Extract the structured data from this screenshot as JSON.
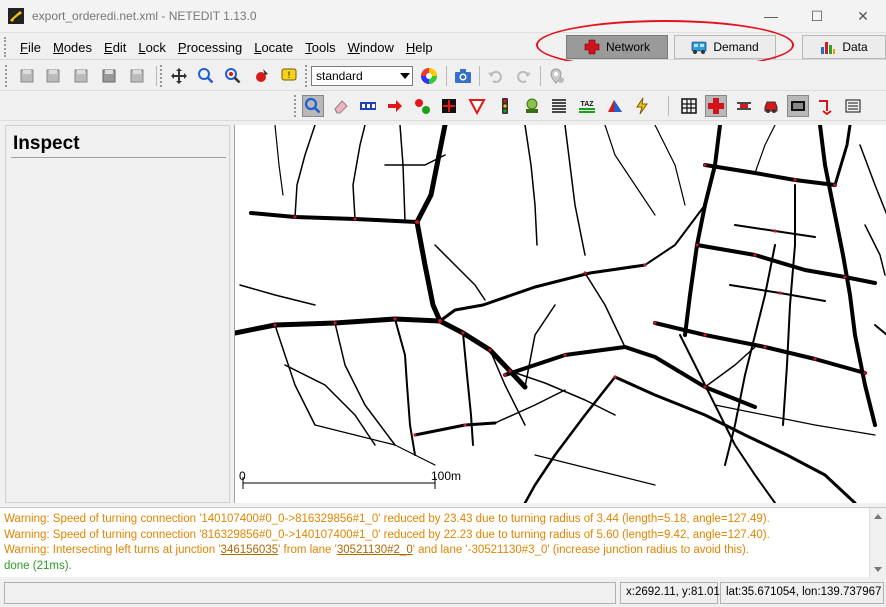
{
  "window": {
    "title": "export_orderedi.net.xml - NETEDIT 1.13.0",
    "controls": {
      "minimize": "—",
      "maximize": "☐",
      "close": "✕"
    }
  },
  "menu": {
    "items": [
      {
        "label": "File",
        "u": "F"
      },
      {
        "label": "Modes",
        "u": "M"
      },
      {
        "label": "Edit",
        "u": "E"
      },
      {
        "label": "Lock",
        "u": "L"
      },
      {
        "label": "Processing",
        "u": "P"
      },
      {
        "label": "Locate",
        "u": "L"
      },
      {
        "label": "Tools",
        "u": "T"
      },
      {
        "label": "Window",
        "u": "W"
      },
      {
        "label": "Help",
        "u": "H"
      }
    ],
    "supermodes": {
      "network": "Network",
      "demand": "Demand",
      "data": "Data",
      "active": "network"
    }
  },
  "toolbar": {
    "scheme_select": "standard"
  },
  "inspect_panel": {
    "title": "Inspect"
  },
  "map": {
    "scale_start": "0",
    "scale_end": "100m"
  },
  "log": {
    "lines": [
      {
        "type": "warn",
        "text": "Warning: Speed of turning connection '140107400#0_0->816329856#1_0' reduced by 23.43 due to turning radius of 3.44 (length=5.18, angle=127.49)."
      },
      {
        "type": "warn",
        "text": "Warning: Speed of turning connection '816329856#0_0->140107400#1_0' reduced by 22.23 due to turning radius of 5.60 (length=9.42, angle=127.40)."
      },
      {
        "type": "warn-links",
        "parts": [
          "Warning: Intersecting left turns at junction '",
          "346156035",
          "' from lane '",
          "30521130#2_0",
          "' and lane '-30521130#3_0' (increase junction radius to avoid this)."
        ]
      },
      {
        "type": "done",
        "text": "done (21ms)."
      }
    ]
  },
  "status": {
    "coords": "x:2692.11, y:81.01",
    "latlon": "lat:35.671054, lon:139.737967"
  },
  "colors": {
    "highlight_ellipse": "#e3131b",
    "warning": "#e28400",
    "done": "#2c9c28"
  }
}
